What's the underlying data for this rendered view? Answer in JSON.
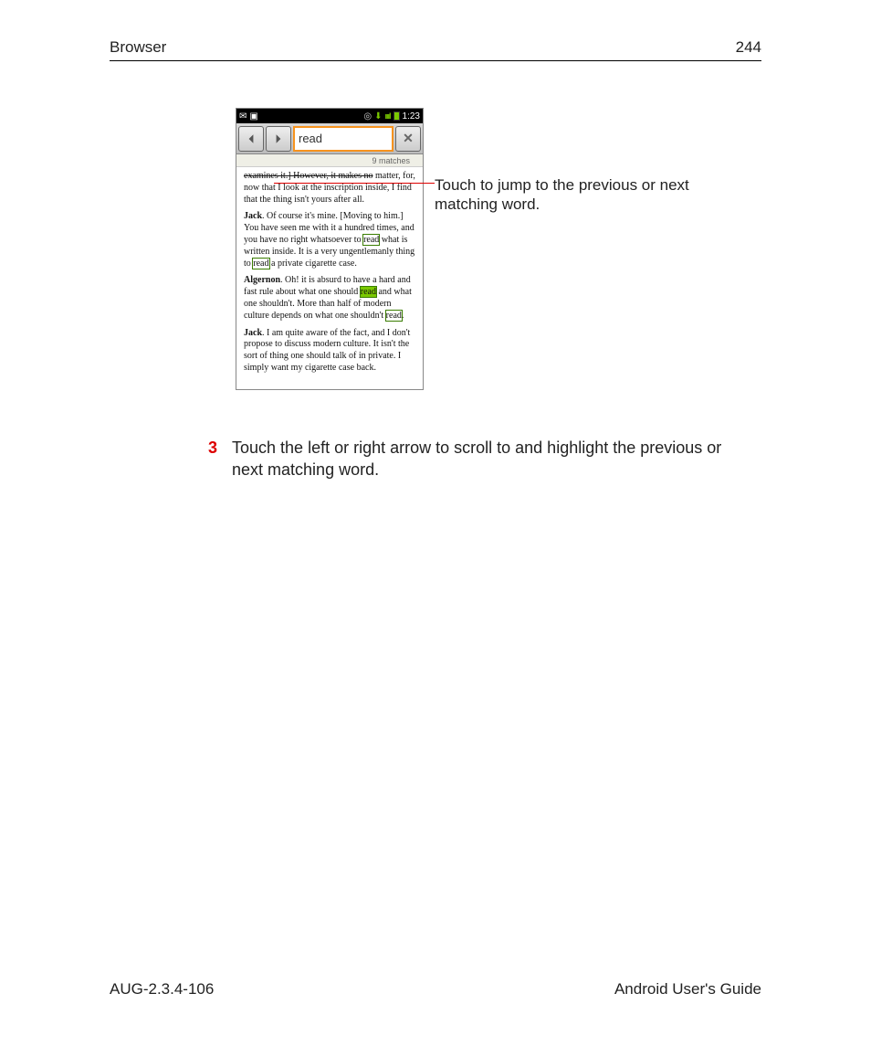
{
  "header": {
    "section": "Browser",
    "page_num": "244"
  },
  "footer": {
    "doc_id": "AUG-2.3.4-106",
    "guide": "Android User's Guide"
  },
  "phone": {
    "status": {
      "time": "1:23",
      "mail_icon": "mail-icon",
      "screen_icon": "screen-icon",
      "target_icon": "target-icon",
      "dl_icon": "download-icon"
    },
    "find": {
      "query": "read",
      "matches_label": "9 matches",
      "prev_icon": "chevron-left-icon",
      "next_icon": "chevron-right-icon",
      "close_icon": "close-icon"
    },
    "content": {
      "p1_a": "examines it.] However, it makes no",
      "p1_b": " matter, for, now that I look at the inscription inside, I find that the thing isn't yours after all.",
      "p2_name": "Jack",
      "p2_a": ". Of course it's mine. [Moving to him.] You have seen me with it a hundred times, and you have no right whatsoever to ",
      "p2_r1": "read",
      "p2_b": " what is written inside. It is a very ungentlemanly thing to ",
      "p2_r2": "read",
      "p2_c": " a private cigarette case.",
      "p3_name": "Algernon",
      "p3_a": ". Oh! it is absurd to have a hard and fast rule about what one should ",
      "p3_r1": "read",
      "p3_b": " and what one shouldn't. More than half of modern culture depends on what one shouldn't ",
      "p3_r2": "read",
      "p3_c": ".",
      "p4_name": "Jack",
      "p4_a": ". I am quite aware of the fact, and I don't propose to discuss modern culture. It isn't the sort of thing one should talk of in private. I simply want my cigarette case back."
    }
  },
  "callout": {
    "text": "Touch to jump to the previous or next matching word."
  },
  "step": {
    "num": "3",
    "text": "Touch the left or right arrow to scroll to and highlight the previous or next matching word."
  }
}
